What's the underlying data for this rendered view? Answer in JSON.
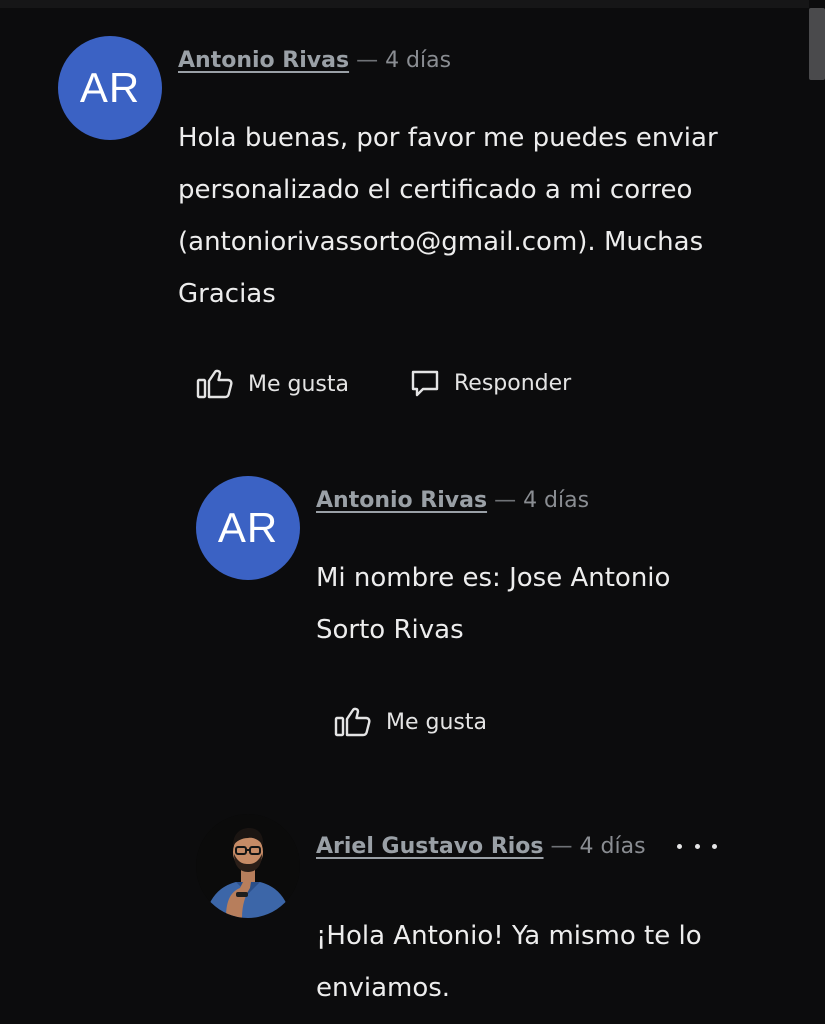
{
  "comments": [
    {
      "avatar_initials": "AR",
      "avatar_color": "#3b62c4",
      "author": "Antonio Rivas",
      "separator": "—",
      "time": "4 días",
      "lines": [
        "Hola buenas, por favor me puedes enviar",
        "personalizado el certificado a mi correo",
        "(antoniorivassorto@gmail.com). Muchas",
        "Gracias"
      ],
      "like_label": "Me gusta",
      "reply_label": "Responder"
    },
    {
      "avatar_initials": "AR",
      "avatar_color": "#3b62c4",
      "author": "Antonio Rivas",
      "separator": "—",
      "time": "4 días",
      "lines": [
        "Mi nombre es: Jose Antonio",
        "Sorto Rivas"
      ],
      "like_label": "Me gusta"
    },
    {
      "avatar_icon": "person-photo-avatar",
      "author": "Ariel Gustavo Rios",
      "separator": "—",
      "time": "4 días",
      "lines": [
        "¡Hola Antonio! Ya mismo te lo",
        "enviamos."
      ],
      "more_icon": "more-horizontal-icon"
    }
  ],
  "colors": {
    "background": "#0c0c0d",
    "avatar_blue": "#3b62c4",
    "meta_gray": "#8a8d92"
  }
}
